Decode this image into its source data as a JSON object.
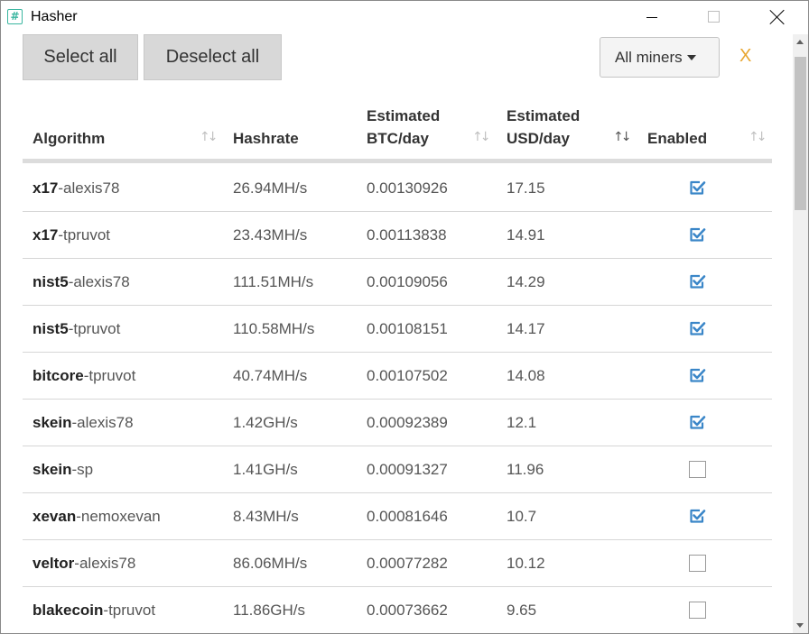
{
  "window": {
    "title": "Hasher"
  },
  "toolbar": {
    "select_all": "Select all",
    "deselect_all": "Deselect all",
    "miners_filter": "All miners",
    "clear": "X"
  },
  "table": {
    "columns": [
      {
        "label": "Algorithm",
        "sub": "",
        "sorted": false
      },
      {
        "label": "Hashrate",
        "sub": "",
        "sorted": false
      },
      {
        "label": "Estimated",
        "sub": "BTC/day",
        "sorted": false
      },
      {
        "label": "Estimated",
        "sub": "USD/day",
        "sorted": true
      },
      {
        "label": "Enabled",
        "sub": "",
        "sorted": false
      }
    ],
    "rows": [
      {
        "algo": "x17",
        "miner": "-alexis78",
        "hashrate": "26.94MH/s",
        "btc": "0.00130926",
        "usd": "17.15",
        "enabled": true
      },
      {
        "algo": "x17",
        "miner": "-tpruvot",
        "hashrate": "23.43MH/s",
        "btc": "0.00113838",
        "usd": "14.91",
        "enabled": true
      },
      {
        "algo": "nist5",
        "miner": "-alexis78",
        "hashrate": "111.51MH/s",
        "btc": "0.00109056",
        "usd": "14.29",
        "enabled": true
      },
      {
        "algo": "nist5",
        "miner": "-tpruvot",
        "hashrate": "110.58MH/s",
        "btc": "0.00108151",
        "usd": "14.17",
        "enabled": true
      },
      {
        "algo": "bitcore",
        "miner": "-tpruvot",
        "hashrate": "40.74MH/s",
        "btc": "0.00107502",
        "usd": "14.08",
        "enabled": true
      },
      {
        "algo": "skein",
        "miner": "-alexis78",
        "hashrate": "1.42GH/s",
        "btc": "0.00092389",
        "usd": "12.1",
        "enabled": true
      },
      {
        "algo": "skein",
        "miner": "-sp",
        "hashrate": "1.41GH/s",
        "btc": "0.00091327",
        "usd": "11.96",
        "enabled": false
      },
      {
        "algo": "xevan",
        "miner": "-nemoxevan",
        "hashrate": "8.43MH/s",
        "btc": "0.00081646",
        "usd": "10.7",
        "enabled": true
      },
      {
        "algo": "veltor",
        "miner": "-alexis78",
        "hashrate": "86.06MH/s",
        "btc": "0.00077282",
        "usd": "10.12",
        "enabled": false
      },
      {
        "algo": "blakecoin",
        "miner": "-tpruvot",
        "hashrate": "11.86GH/s",
        "btc": "0.00073662",
        "usd": "9.65",
        "enabled": false
      }
    ]
  },
  "colors": {
    "accent": "#3a86c8",
    "clear": "#e8a630",
    "app_icon": "#3ab6a0"
  },
  "icons": {
    "app": "hash-icon",
    "sort": "sort-arrows-icon",
    "check": "checkbox-checked-icon"
  }
}
